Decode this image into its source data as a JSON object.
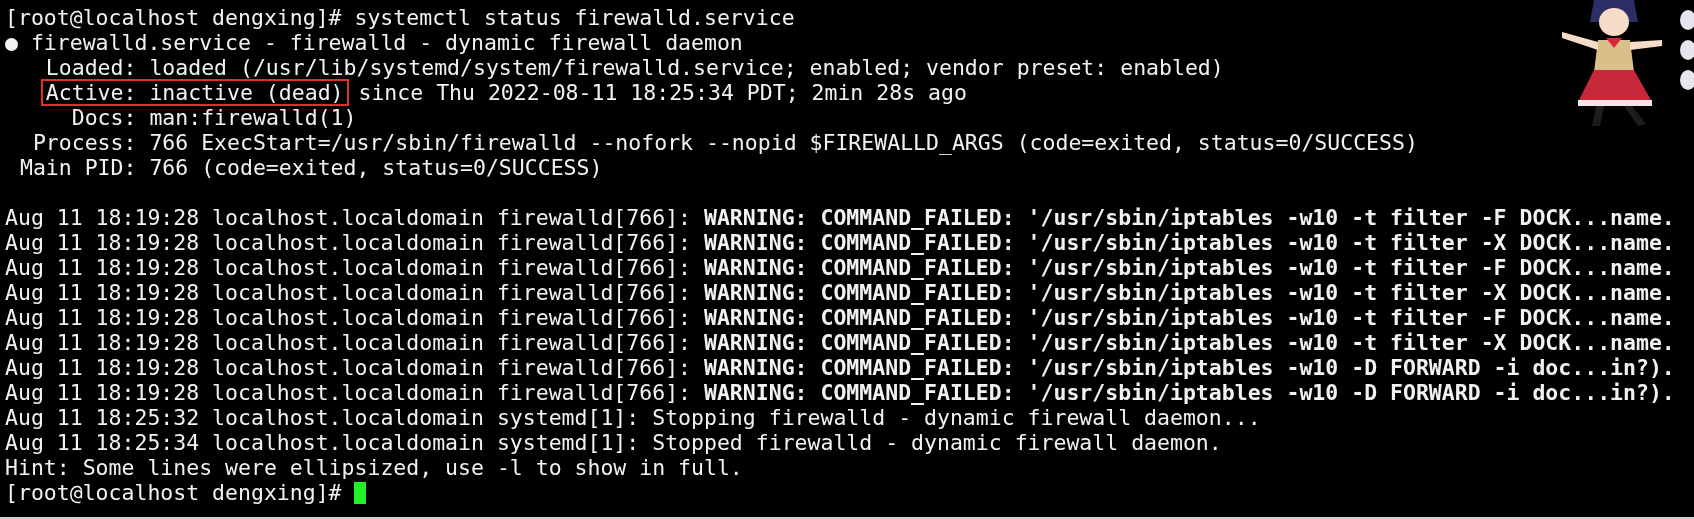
{
  "prompt_line": {
    "prompt": "[root@localhost dengxing]#",
    "command": "systemctl status firewalld.service"
  },
  "unit": {
    "bullet": "●",
    "title": "firewalld.service - firewalld - dynamic firewall daemon"
  },
  "fields": [
    {
      "label": "Loaded:",
      "value": "loaded (/usr/lib/systemd/system/firewalld.service; enabled; vendor preset: enabled)",
      "boxed": false
    },
    {
      "label": "Active:",
      "value": "inactive (dead)",
      "detail": "since Thu 2022-08-11 18:25:34 PDT; 2min 28s ago",
      "boxed": true
    },
    {
      "label": "Docs:",
      "value": "man:firewalld(1)",
      "boxed": false
    },
    {
      "label": "Process:",
      "value": "766 ExecStart=/usr/sbin/firewalld --nofork --nopid $FIREWALLD_ARGS (code=exited, status=0/SUCCESS)",
      "boxed": false
    },
    {
      "label": "Main PID:",
      "value": "766 (code=exited, status=0/SUCCESS)",
      "boxed": false
    }
  ],
  "log": [
    "Aug 11 18:19:28 localhost.localdomain firewalld[766]: **WARNING: COMMAND_FAILED: '/usr/sbin/iptables -w10 -t filter -F DOCK...name.**",
    "Aug 11 18:19:28 localhost.localdomain firewalld[766]: **WARNING: COMMAND_FAILED: '/usr/sbin/iptables -w10 -t filter -X DOCK...name.**",
    "Aug 11 18:19:28 localhost.localdomain firewalld[766]: **WARNING: COMMAND_FAILED: '/usr/sbin/iptables -w10 -t filter -F DOCK...name.**",
    "Aug 11 18:19:28 localhost.localdomain firewalld[766]: **WARNING: COMMAND_FAILED: '/usr/sbin/iptables -w10 -t filter -X DOCK...name.**",
    "Aug 11 18:19:28 localhost.localdomain firewalld[766]: **WARNING: COMMAND_FAILED: '/usr/sbin/iptables -w10 -t filter -F DOCK...name.**",
    "Aug 11 18:19:28 localhost.localdomain firewalld[766]: **WARNING: COMMAND_FAILED: '/usr/sbin/iptables -w10 -t filter -X DOCK...name.**",
    "Aug 11 18:19:28 localhost.localdomain firewalld[766]: **WARNING: COMMAND_FAILED: '/usr/sbin/iptables -w10 -D FORWARD -i doc...in?).**",
    "Aug 11 18:19:28 localhost.localdomain firewalld[766]: **WARNING: COMMAND_FAILED: '/usr/sbin/iptables -w10 -D FORWARD -i doc...in?).**",
    "Aug 11 18:25:32 localhost.localdomain systemd[1]: Stopping firewalld - dynamic firewall daemon...",
    "Aug 11 18:25:34 localhost.localdomain systemd[1]: Stopped firewalld - dynamic firewall daemon."
  ],
  "hint": "Hint: Some lines were ellipsized, use -l to show in full.",
  "final_prompt": {
    "prompt": "[root@localhost dengxing]#",
    "cursor": true
  }
}
